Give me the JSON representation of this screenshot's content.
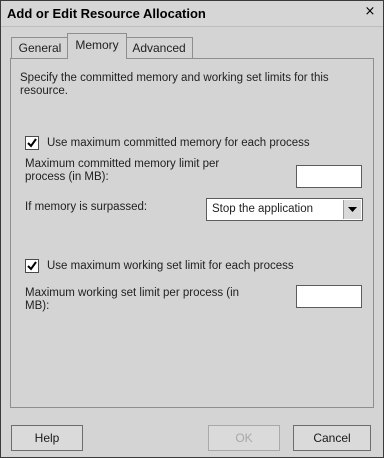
{
  "window": {
    "title": "Add or Edit Resource Allocation",
    "close_glyph": "×"
  },
  "tabs": [
    {
      "label": "General"
    },
    {
      "label": "Memory",
      "active": true
    },
    {
      "label": "Advanced"
    }
  ],
  "memory": {
    "description": "Specify the committed memory and working set limits for this resource.",
    "committed": {
      "checkbox_label": "Use maximum committed memory for each process",
      "checked": true,
      "limit_label": "Maximum committed memory limit per process (in MB):",
      "limit_value": "",
      "surpassed_label": "If memory is surpassed:",
      "surpassed_value": "Stop the application"
    },
    "working_set": {
      "checkbox_label": "Use maximum working set limit for each process",
      "checked": true,
      "limit_label": "Maximum working set limit per process (in MB):",
      "limit_value": ""
    }
  },
  "buttons": {
    "help": "Help",
    "ok": "OK",
    "cancel": "Cancel"
  }
}
